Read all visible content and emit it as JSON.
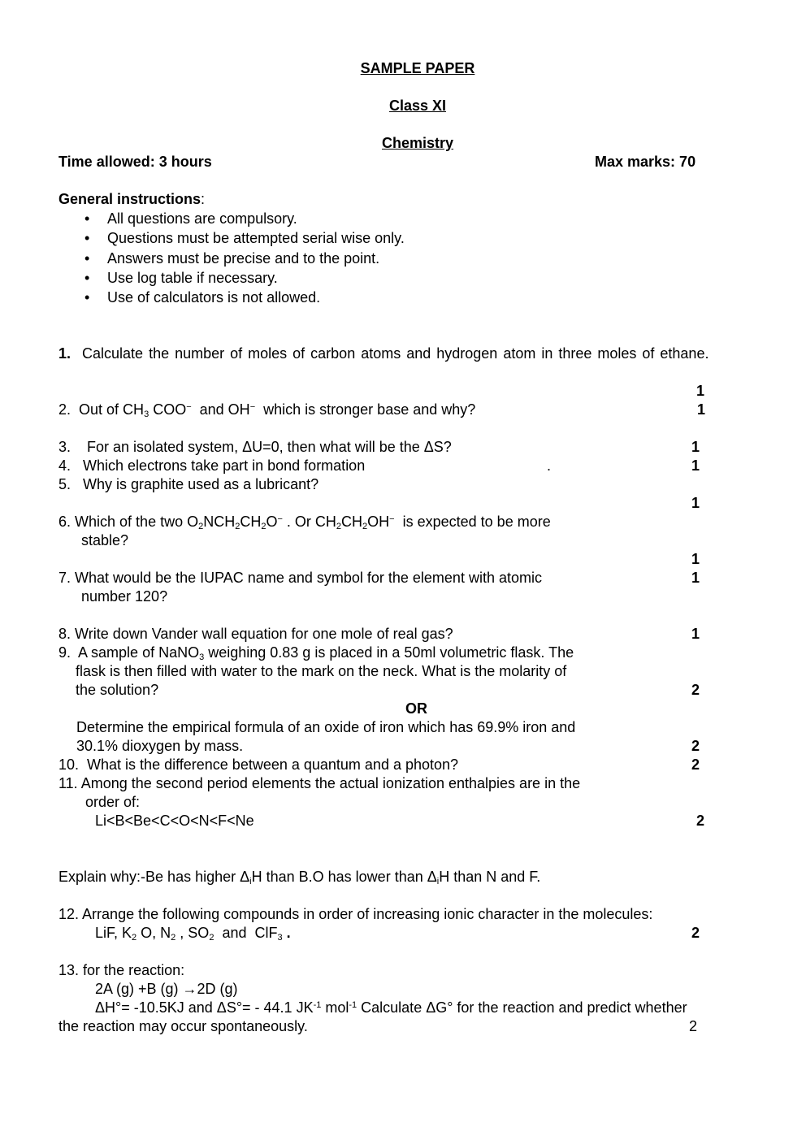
{
  "header": {
    "title": "SAMPLE PAPER",
    "class": "Class XI",
    "subject": "Chemistry",
    "time_allowed": "Time allowed: 3 hours",
    "max_marks": "Max marks: 70"
  },
  "instructions": {
    "heading": "General instructions",
    "colon": ":",
    "bullet": "•",
    "items": [
      "All questions are compulsory.",
      "Questions must be attempted serial wise only.",
      "Answers must be precise and to the point.",
      "Use log table if necessary.",
      "Use of calculators is not allowed."
    ]
  },
  "questions": {
    "q1": {
      "num": "1.",
      "text": "Calculate the number of moles of carbon atoms and hydrogen atom in three moles of ethane.",
      "marks": "1"
    },
    "q2": {
      "num": "2.",
      "a": "Out of CH",
      "s1": "3",
      "b": " COO",
      "s2": "−",
      "c": "  and OH",
      "s3": "−",
      "d": "  which is stronger base and why?",
      "marks": "1"
    },
    "q3": {
      "num": "3.",
      "text": "For an isolated system, ΔU=0, then what will be the ΔS?",
      "marks": "1"
    },
    "q4": {
      "num": "4.",
      "text": "Which electrons take part in bond formation",
      "dot": ".",
      "marks": "1"
    },
    "q5": {
      "num": "5.",
      "text": "Why is graphite used as a lubricant?",
      "marks": "1"
    },
    "q6": {
      "num": "6.",
      "a": "Which of the two O",
      "s1": "2",
      "b": "NCH",
      "s2": "2",
      "c": "CH",
      "s3": "2",
      "d": "O",
      "s4": "−",
      "e": " . Or CH",
      "s5": "2",
      "f": "CH",
      "s6": "2",
      "g": "OH",
      "s7": "−",
      "h": "  is expected to be more",
      "line2": "stable?",
      "marks": "1"
    },
    "q7": {
      "num": "7.",
      "line1": "What would be the IUPAC name and symbol for the element with atomic",
      "line2": "number 120?",
      "marks": "1"
    },
    "q8": {
      "num": "8.",
      "text": "Write down Vander wall equation for one mole of real gas?",
      "marks": "1"
    },
    "q9": {
      "num": "9.",
      "a": "A sample of NaNO",
      "s1": "3",
      "b": " weighing 0.83 g is placed in a 50ml volumetric flask. The",
      "line2": "flask is then filled with water to the mark on the neck. What is the molarity of",
      "line3": "the solution?",
      "marks": "2",
      "or": "OR",
      "alt_line1": "Determine the empirical formula of an oxide of iron which has 69.9% iron and",
      "alt_line2": "30.1% dioxygen by mass.",
      "alt_marks": "2"
    },
    "q10": {
      "num": "10.",
      "text": "What is the difference between a quantum and a photon?",
      "marks": "2"
    },
    "q11": {
      "num": "11.",
      "line1": "Among the second period elements the actual ionization enthalpies are in the",
      "line2": "order of:",
      "line3": "Li<B<Be<C<O<N<F<Ne",
      "marks": "2",
      "explain_a": "Explain why:-Be has higher Δ",
      "s1": "i",
      "explain_b": "H than B.O has lower than Δ",
      "s2": "i",
      "explain_c": "H than N and F."
    },
    "q12": {
      "num": "12.",
      "line1": "Arrange the following compounds in order of increasing ionic character in the molecules:",
      "a": "LiF, K",
      "s1": "2",
      "b": " O, N",
      "s2": "2",
      "c": " , SO",
      "s3": "2",
      "d": "  and  ClF",
      "s4": "3",
      "e": " .",
      "marks": "2"
    },
    "q13": {
      "num": "13.",
      "line1": "for the reaction:",
      "line2": "2A (g) +B (g) →2D (g)",
      "a": "ΔH°= -10.5KJ and ΔS°= - 44.1 JK",
      "s1": "-1",
      "b": " mol",
      "s2": "-1",
      "c": " Calculate ΔG° for the reaction and predict whether",
      "line4": "the reaction may occur spontaneously.",
      "marks": "2"
    }
  }
}
